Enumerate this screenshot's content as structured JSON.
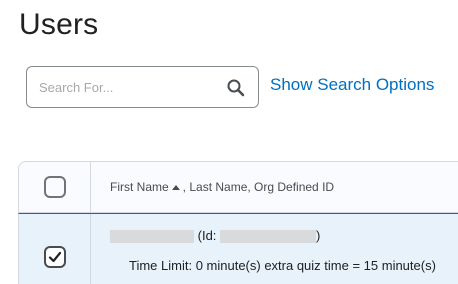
{
  "page": {
    "title": "Users"
  },
  "search": {
    "placeholder": "Search For...",
    "value": "",
    "show_options_label": "Show Search Options"
  },
  "grid": {
    "header": {
      "sort_label_first": "First Name",
      "sort_label_rest": ", Last Name, Org Defined ID",
      "select_all_checked": false
    },
    "rows": [
      {
        "selected": true,
        "id_prefix": "(Id:",
        "id_suffix": ")",
        "detail": "Time Limit: 0 minute(s) extra quiz time = 15 minute(s)"
      }
    ]
  },
  "icons": {
    "search": "search-icon",
    "sort": "sort-ascending-icon",
    "check": "check-icon"
  },
  "colors": {
    "link": "#006fbf",
    "selected_row": "#e8f2fb",
    "header_bg": "#f9fbff"
  }
}
